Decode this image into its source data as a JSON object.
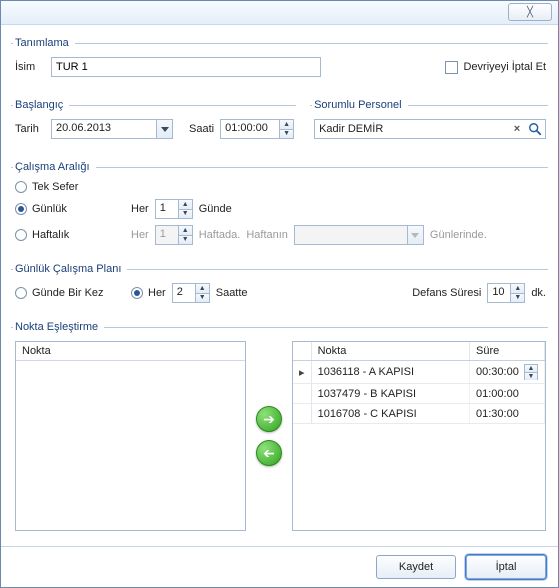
{
  "titlebar": {
    "close_glyph": "✕"
  },
  "tanimlama": {
    "legend": "Tanımlama",
    "isim_label": "İsim",
    "isim_value": "TUR 1",
    "cancel_cycle_label": "Devriyeyi İptal Et"
  },
  "baslangic": {
    "legend": "Başlangıç",
    "tarih_label": "Tarih",
    "tarih_value": "20.06.2013",
    "saati_label": "Saati",
    "saati_value": "01:00:00"
  },
  "sorumlu": {
    "legend": "Sorumlu Personel",
    "value": "Kadir DEMİR"
  },
  "calisma_araligi": {
    "legend": "Çalışma Aralığı",
    "tek_sefer": "Tek Sefer",
    "gunluk": "Günlük",
    "haftalik": "Haftalık",
    "her": "Her",
    "gun_value": "1",
    "gunde": "Günde",
    "hafta_value": "1",
    "haftada": "Haftada.",
    "haftanin": "Haftanın",
    "gunlerinde": "Günlerinde."
  },
  "gunluk_plan": {
    "legend": "Günlük Çalışma Planı",
    "gunde_bir_kez": "Günde Bir Kez",
    "her": "Her",
    "her_value": "2",
    "saatte": "Saatte",
    "defans_label": "Defans Süresi",
    "defans_value": "10",
    "dk": "dk."
  },
  "eslestirme": {
    "legend": "Nokta Eşleştirme",
    "left_header": "Nokta",
    "right_headers": {
      "nokta": "Nokta",
      "sure": "Süre"
    },
    "rows": [
      {
        "nokta": "1036118 - A KAPISI",
        "sure": "00:30:00",
        "selected": true
      },
      {
        "nokta": "1037479 - B KAPISI",
        "sure": "01:00:00",
        "selected": false
      },
      {
        "nokta": "1016708 - C KAPISI",
        "sure": "01:30:00",
        "selected": false
      }
    ]
  },
  "footer": {
    "save": "Kaydet",
    "cancel": "İptal"
  }
}
